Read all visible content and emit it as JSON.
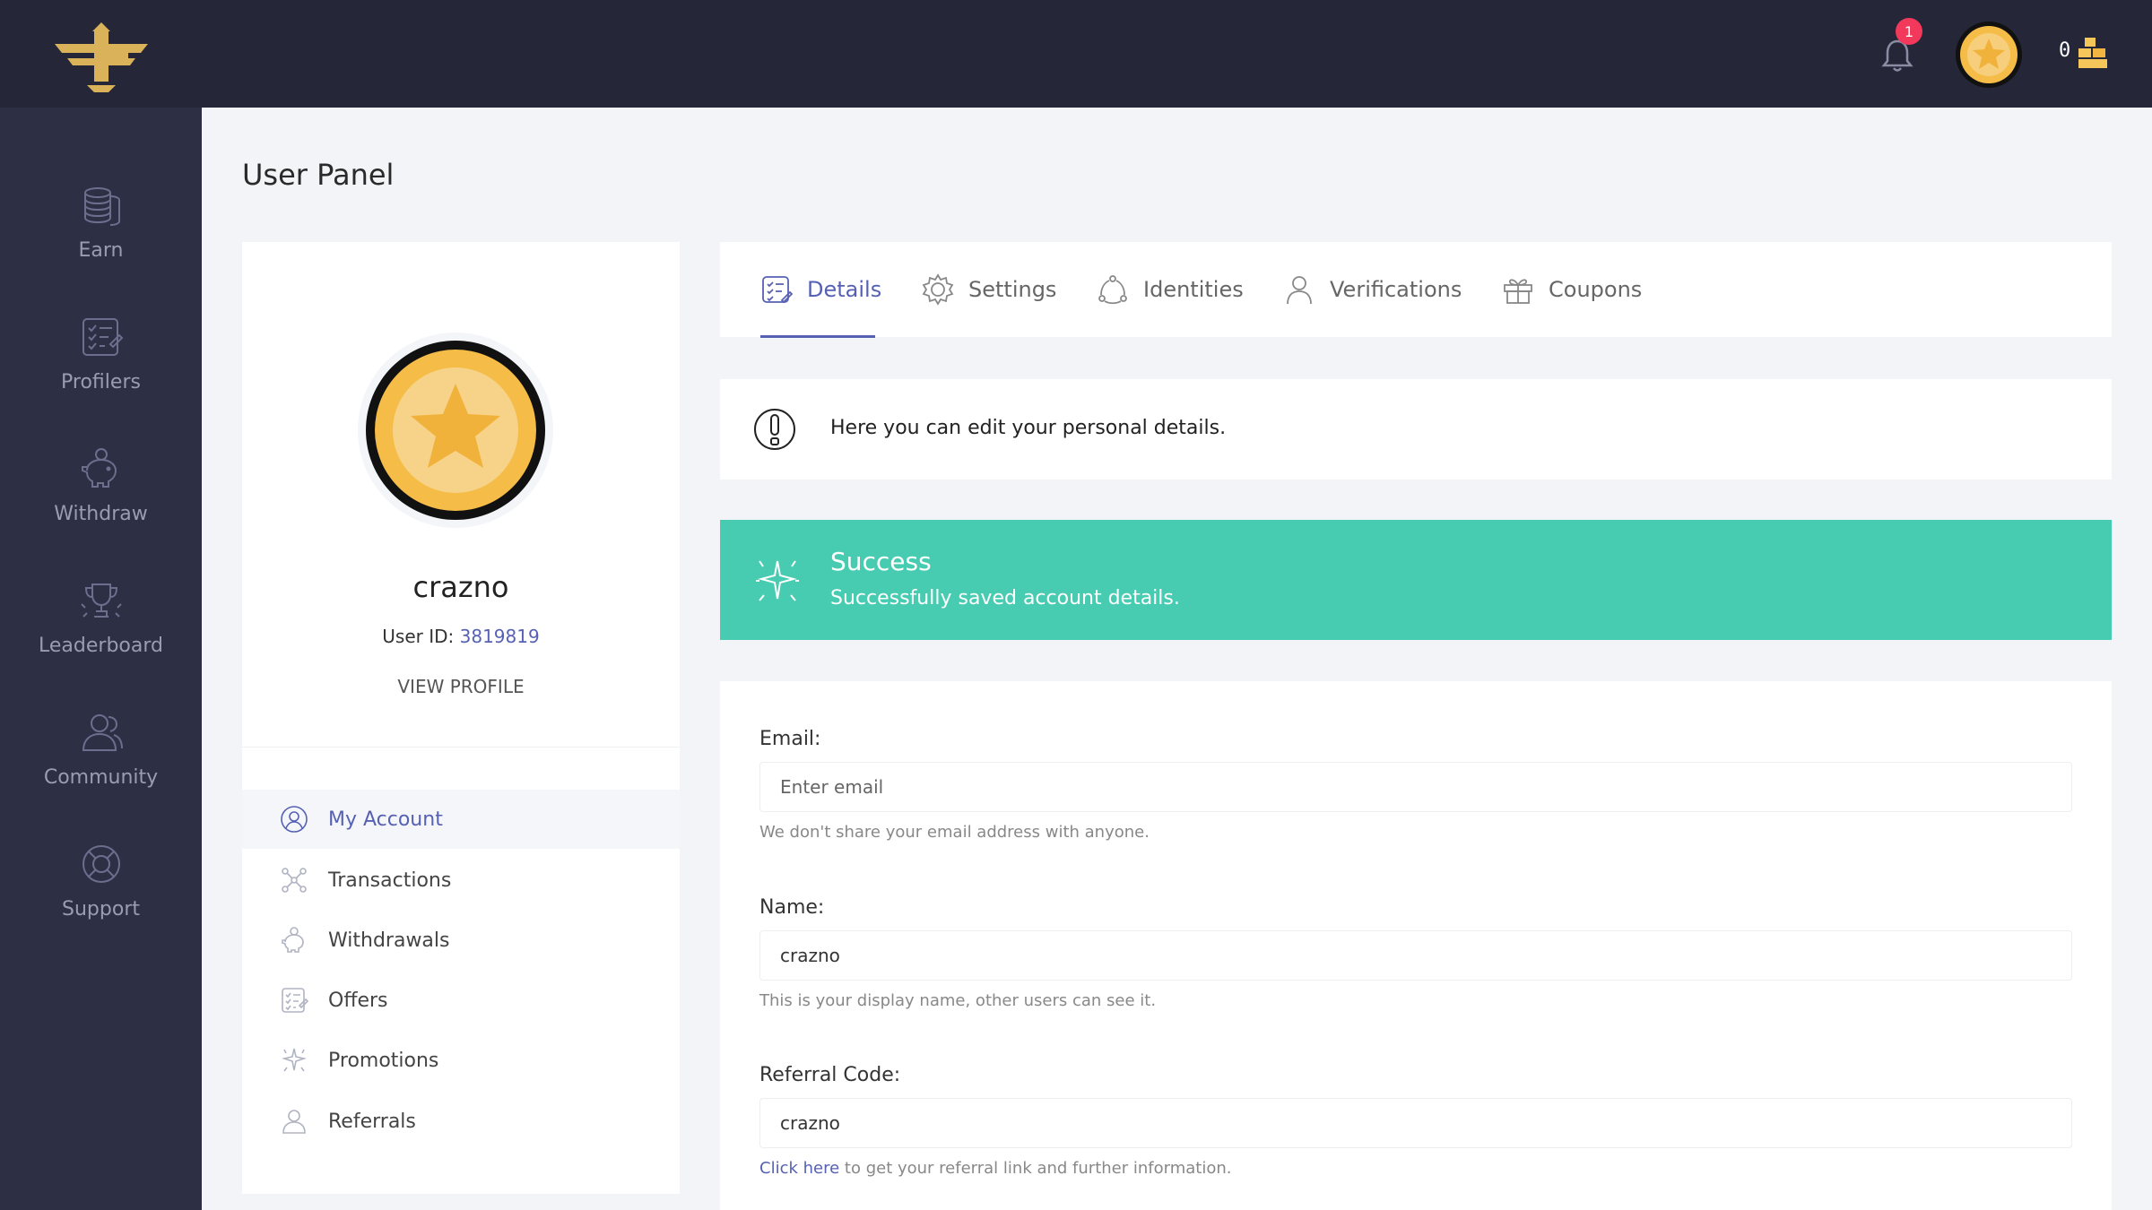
{
  "topbar": {
    "notification_count": "1",
    "coin_balance": "0"
  },
  "sidebar": {
    "items": [
      {
        "label": "Earn",
        "icon": "coins-icon"
      },
      {
        "label": "Profilers",
        "icon": "checklist-icon"
      },
      {
        "label": "Withdraw",
        "icon": "piggy-bank-icon"
      },
      {
        "label": "Leaderboard",
        "icon": "trophy-icon"
      },
      {
        "label": "Community",
        "icon": "users-icon"
      },
      {
        "label": "Support",
        "icon": "lifebuoy-icon"
      }
    ]
  },
  "page": {
    "title": "User Panel"
  },
  "profile": {
    "username": "crazno",
    "user_id_label": "User ID:",
    "user_id": "3819819",
    "view_profile": "VIEW PROFILE",
    "menu": [
      {
        "label": "My Account",
        "icon": "account-icon",
        "active": true
      },
      {
        "label": "Transactions",
        "icon": "transactions-icon"
      },
      {
        "label": "Withdrawals",
        "icon": "piggy-bank-icon"
      },
      {
        "label": "Offers",
        "icon": "checklist-icon"
      },
      {
        "label": "Promotions",
        "icon": "sparkle-icon"
      },
      {
        "label": "Referrals",
        "icon": "user-icon"
      }
    ]
  },
  "tabs": [
    {
      "label": "Details",
      "icon": "checklist-icon",
      "active": true
    },
    {
      "label": "Settings",
      "icon": "gear-icon"
    },
    {
      "label": "Identities",
      "icon": "cycle-icon"
    },
    {
      "label": "Verifications",
      "icon": "user-icon"
    },
    {
      "label": "Coupons",
      "icon": "gift-icon"
    }
  ],
  "info": {
    "text": "Here you can edit your personal details."
  },
  "alert": {
    "title": "Success",
    "message": "Successfully saved account details.",
    "color": "#47ccb1"
  },
  "form": {
    "email": {
      "label": "Email:",
      "placeholder": "Enter email",
      "value": "",
      "help": "We don't share your email address with anyone."
    },
    "name": {
      "label": "Name:",
      "value": "crazno",
      "help": "This is your display name, other users can see it."
    },
    "referral": {
      "label": "Referral Code:",
      "value": "crazno",
      "help_link": "Click here",
      "help_rest": " to get your referral link and further information."
    }
  },
  "colors": {
    "accent": "#5661b3",
    "topbar": "#252638",
    "sidebar": "#2d2f45",
    "badge": "#f2395b",
    "gold": "#f5bd47"
  }
}
